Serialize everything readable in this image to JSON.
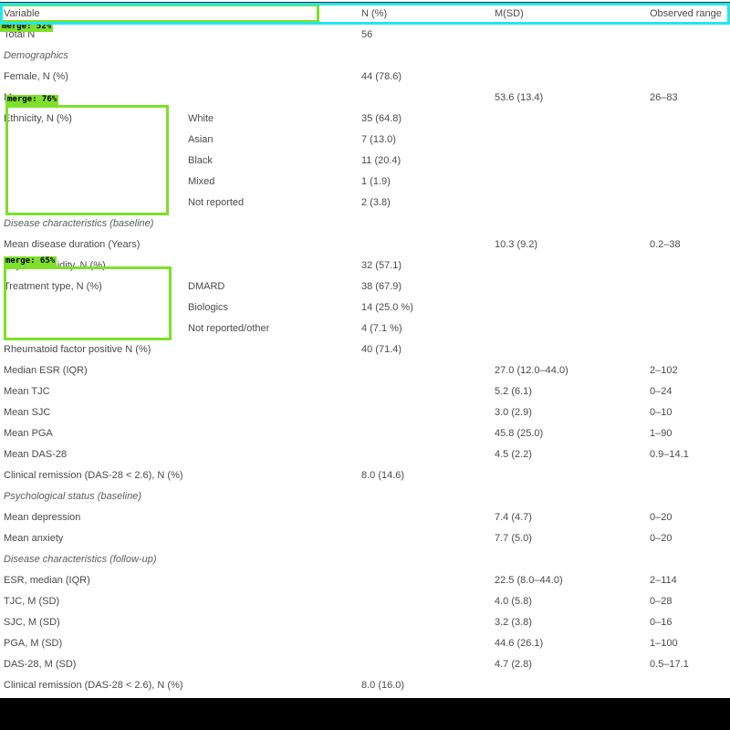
{
  "table": {
    "headers": [
      "Variable",
      "N (%)",
      "M(SD)",
      "Observed range"
    ],
    "rows": [
      {
        "variable": "Total N",
        "sub": "",
        "n": "56",
        "msd": "",
        "range": "",
        "section": false
      },
      {
        "variable": "Demographics",
        "sub": "",
        "n": "",
        "msd": "",
        "range": "",
        "section": true
      },
      {
        "variable": "Female, N (%)",
        "sub": "",
        "n": "44 (78.6)",
        "msd": "",
        "range": "",
        "section": false
      },
      {
        "variable": "Mean age",
        "sub": "",
        "n": "",
        "msd": "53.6 (13.4)",
        "range": "26–83",
        "section": false
      },
      {
        "variable": "Ethnicity, N (%)",
        "sub": "White",
        "n": "35 (64.8)",
        "msd": "",
        "range": "",
        "section": false
      },
      {
        "variable": "",
        "sub": "Asian",
        "n": "7 (13.0)",
        "msd": "",
        "range": "",
        "section": false
      },
      {
        "variable": "",
        "sub": "Black",
        "n": "11 (20.4)",
        "msd": "",
        "range": "",
        "section": false
      },
      {
        "variable": "",
        "sub": "Mixed",
        "n": "1 (1.9)",
        "msd": "",
        "range": "",
        "section": false
      },
      {
        "variable": "",
        "sub": "Not reported",
        "n": "2 (3.8)",
        "msd": "",
        "range": "",
        "section": false
      },
      {
        "variable": "Disease characteristics (baseline)",
        "sub": "",
        "n": "",
        "msd": "",
        "range": "",
        "section": true
      },
      {
        "variable": "Mean disease duration (Years)",
        "sub": "",
        "n": "",
        "msd": "10.3 (9.2)",
        "range": "0.2–38",
        "section": false
      },
      {
        "variable": "Any comorbidity, N (%)",
        "sub": "",
        "n": "32 (57.1)",
        "msd": "",
        "range": "",
        "section": false
      },
      {
        "variable": "Treatment type, N (%)",
        "sub": "DMARD",
        "n": "38 (67.9)",
        "msd": "",
        "range": "",
        "section": false
      },
      {
        "variable": "",
        "sub": "Biologics",
        "n": "14 (25.0 %)",
        "msd": "",
        "range": "",
        "section": false
      },
      {
        "variable": "",
        "sub": "Not reported/other",
        "n": "4 (7.1 %)",
        "msd": "",
        "range": "",
        "section": false
      },
      {
        "variable": "Rheumatoid factor positive N (%)",
        "sub": "",
        "n": "40 (71.4)",
        "msd": "",
        "range": "",
        "section": false
      },
      {
        "variable": "Median ESR (IQR)",
        "sub": "",
        "n": "",
        "msd": "27.0 (12.0–44.0)",
        "range": "2–102",
        "section": false
      },
      {
        "variable": "Mean TJC",
        "sub": "",
        "n": "",
        "msd": "5.2 (6.1)",
        "range": "0–24",
        "section": false
      },
      {
        "variable": "Mean SJC",
        "sub": "",
        "n": "",
        "msd": "3.0 (2.9)",
        "range": "0–10",
        "section": false
      },
      {
        "variable": "Mean PGA",
        "sub": "",
        "n": "",
        "msd": "45.8 (25.0)",
        "range": "1–90",
        "section": false
      },
      {
        "variable": "Mean DAS-28",
        "sub": "",
        "n": "",
        "msd": "4.5 (2.2)",
        "range": "0.9–14.1",
        "section": false
      },
      {
        "variable": "Clinical remission (DAS-28 < 2.6), N (%)",
        "sub": "",
        "n": "8.0 (14.6)",
        "msd": "",
        "range": "",
        "section": false
      },
      {
        "variable": "Psychological status (baseline)",
        "sub": "",
        "n": "",
        "msd": "",
        "range": "",
        "section": true
      },
      {
        "variable": "Mean depression",
        "sub": "",
        "n": "",
        "msd": "7.4 (4.7)",
        "range": "0–20",
        "section": false
      },
      {
        "variable": "Mean anxiety",
        "sub": "",
        "n": "",
        "msd": "7.7 (5.0)",
        "range": "0–20",
        "section": false
      },
      {
        "variable": "Disease characteristics (follow-up)",
        "sub": "",
        "n": "",
        "msd": "",
        "range": "",
        "section": true
      },
      {
        "variable": "ESR, median (IQR)",
        "sub": "",
        "n": "",
        "msd": "22.5 (8.0–44.0)",
        "range": "2–114",
        "section": false
      },
      {
        "variable": "TJC, M (SD)",
        "sub": "",
        "n": "",
        "msd": "4.0 (5.8)",
        "range": "0–28",
        "section": false
      },
      {
        "variable": "SJC, M (SD)",
        "sub": "",
        "n": "",
        "msd": "3.2 (3.8)",
        "range": "0–16",
        "section": false
      },
      {
        "variable": "PGA, M (SD)",
        "sub": "",
        "n": "",
        "msd": "44.6 (26.1)",
        "range": "1–100",
        "section": false
      },
      {
        "variable": "DAS-28, M (SD)",
        "sub": "",
        "n": "",
        "msd": "4.7 (2.8)",
        "range": "0.5–17.1",
        "section": false
      },
      {
        "variable": "Clinical remission (DAS-28 < 2.6), N (%)",
        "sub": "",
        "n": "8.0 (16.0)",
        "msd": "",
        "range": "",
        "section": false
      }
    ]
  },
  "overlays": [
    {
      "name": "header-variable-box",
      "label": "merge: 52%",
      "color": "#7ee02a"
    },
    {
      "name": "header-row-box",
      "label": "",
      "color": "#22e6ee"
    },
    {
      "name": "ethnicity-box",
      "label": "merge: 76%",
      "color": "#7ee02a"
    },
    {
      "name": "treatment-box",
      "label": "merge: 65%",
      "color": "#7ee02a"
    }
  ]
}
